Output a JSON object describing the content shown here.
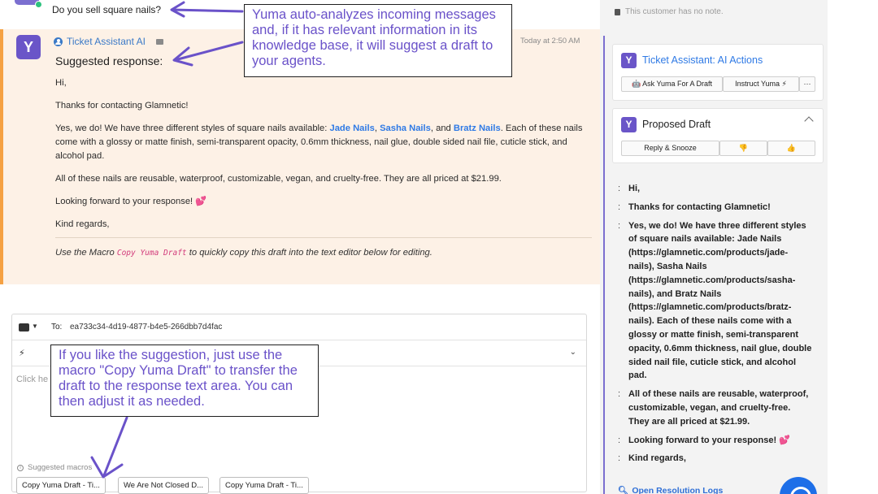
{
  "top_message": {
    "text": "Do you sell square nails?"
  },
  "note": {
    "author": "Ticket Assistant AI",
    "time": "Today at 2:50 AM",
    "heading": "Suggested response:",
    "greeting": "Hi,",
    "thanks": "Thanks for contacting Glamnetic!",
    "body_prefix": "Yes, we do! We have three different styles of square nails available: ",
    "links": [
      "Jade Nails",
      "Sasha Nails",
      "Bratz Nails"
    ],
    "sep1": ", ",
    "sep2": ", and ",
    "body_suffix": ". Each of these nails come with a glossy or matte finish, semi-transparent opacity, 0.6mm thickness, nail glue, double sided nail file, cuticle stick, and alcohol pad.",
    "para2": "All of these nails are reusable, waterproof, customizable, vegan, and cruelty-free. They are all priced at $21.99.",
    "para3": "Looking forward to your response! 💕",
    "closing": "Kind regards,",
    "footer_pre": "Use the Macro ",
    "footer_macro": "Copy Yuma Draft",
    "footer_post": " to quickly copy this draft into the text editor below for editing."
  },
  "composer": {
    "to_label": "To:",
    "to_value": "ea733c34-4d19-4877-b4e5-266dbb7d4fac",
    "placeholder": "Click he",
    "suggested_label": "Suggested macros",
    "macros": [
      "Copy Yuma Draft - Ti...",
      "We Are Not Closed D...",
      "Copy Yuma Draft - Ti..."
    ]
  },
  "sidebar": {
    "no_note": "This customer has no note.",
    "ai_actions": {
      "logo": "Y",
      "title": "Ticket Assistant: AI Actions",
      "ask_btn": "🤖 Ask Yuma For A Draft",
      "instruct_btn": "Instruct Yuma ⚡",
      "more_btn": "···"
    },
    "proposed": {
      "logo": "Y",
      "title": "Proposed Draft",
      "reply_btn": "Reply & Snooze",
      "down_btn": "👎",
      "up_btn": "👍"
    },
    "draft_paragraphs": [
      "Hi,",
      "Thanks for contacting Glamnetic!",
      "Yes, we do! We have three different styles of square nails available: Jade Nails (https://glamnetic.com/products/jade-nails), Sasha Nails (https://glamnetic.com/products/sasha-nails), and Bratz Nails (https://glamnetic.com/products/bratz-nails). Each of these nails come with a glossy or matte finish, semi-transparent opacity, 0.6mm thickness, nail glue, double sided nail file, cuticle stick, and alcohol pad.",
      "All of these nails are reusable, waterproof, customizable, vegan, and cruelty-free. They are all priced at $21.99.",
      "Looking forward to your response! 💕",
      "Kind regards,"
    ],
    "open_logs": "Open Resolution Logs"
  },
  "callouts": {
    "top": "Yuma auto-analyzes incoming messages and, if it has relevant information in its knowledge base, it will suggest a draft to your agents.",
    "bottom": "If you like the suggestion, just use the macro \"Copy Yuma Draft\" to transfer the draft to the response text area. You can then adjust it as needed."
  },
  "colors": {
    "brand": "#6a55c8",
    "annotation": "#6a52c9",
    "note_bg": "#fdf1e6",
    "note_border": "#f5a142",
    "link": "#2f7ae5"
  }
}
